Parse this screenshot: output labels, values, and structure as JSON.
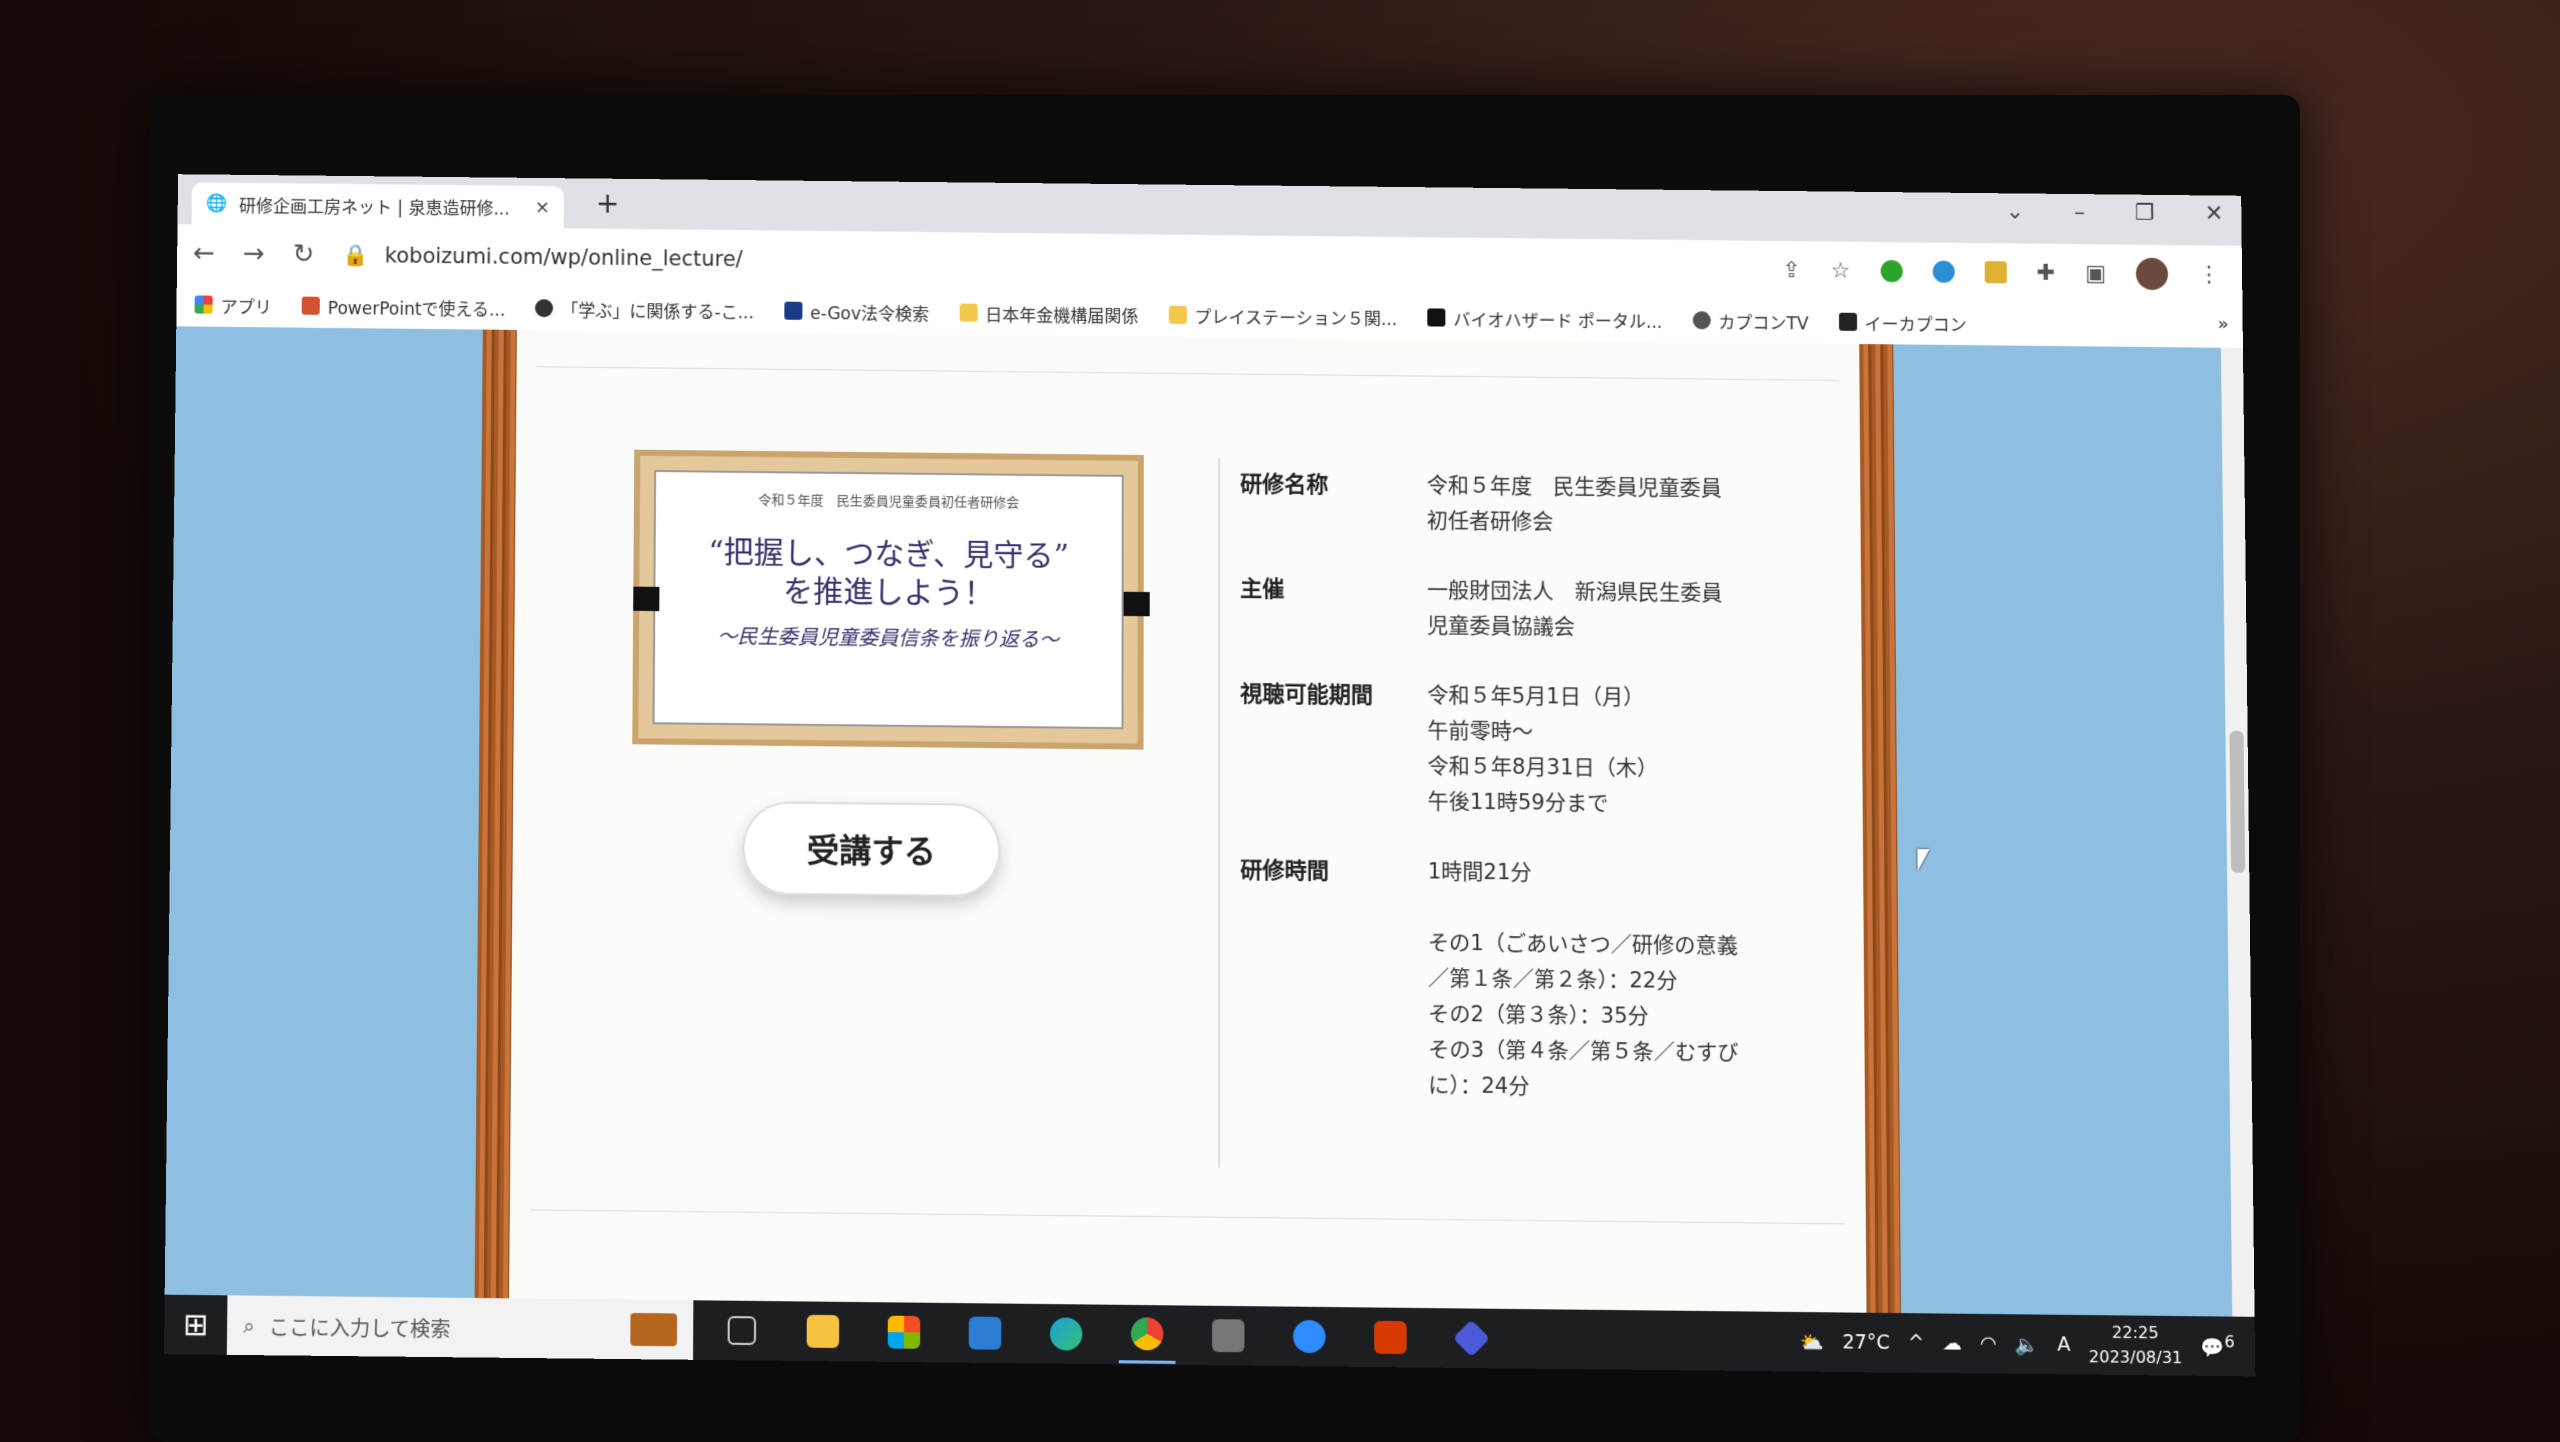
{
  "browser": {
    "tab_title": "研修企画工房ネット | 泉恵造研修...",
    "tab_close": "×",
    "new_tab": "+",
    "url": "koboizumi.com/wp/online_lecture/",
    "bookmarks": [
      "アプリ",
      "PowerPointで使える...",
      "「学ぶ」に関係する-こ...",
      "e-Gov法令検索",
      "日本年金機構届関係",
      "プレイステーション５関...",
      "バイオハザード ポータル...",
      "カプコンTV",
      "イーカプコン"
    ],
    "bookmarks_more": "»"
  },
  "page": {
    "banner": {
      "small": "令和５年度　民生委員児童委員初任者研修会",
      "main_1": "“把握し、つなぎ、見守る”",
      "main_2": "を推進しよう！",
      "sub": "～民生委員児童委員信条を振り返る～"
    },
    "enroll_button": "受講する",
    "info": [
      {
        "key": "研修名称",
        "lines": [
          "令和５年度　民生委員児童委員",
          "初任者研修会"
        ]
      },
      {
        "key": "主催",
        "lines": [
          "一般財団法人　新潟県民生委員",
          "児童委員協議会"
        ]
      },
      {
        "key": "視聴可能期間",
        "lines": [
          "令和５年5月1日（月）",
          "午前零時～",
          "令和５年8月31日（木）",
          "午後11時59分まで"
        ]
      },
      {
        "key": "研修時間",
        "lines": [
          "1時間21分",
          "",
          "その1（ごあいさつ／研修の意義",
          "／第１条／第２条）：22分",
          "その2（第３条）：35分",
          "その3（第４条／第５条／むすび",
          "に）：24分"
        ]
      }
    ]
  },
  "taskbar": {
    "search_placeholder": "ここに入力して検索",
    "weather": "27°C",
    "ime": "A",
    "time": "22:25",
    "date": "2023/08/31",
    "notifications": "6"
  }
}
